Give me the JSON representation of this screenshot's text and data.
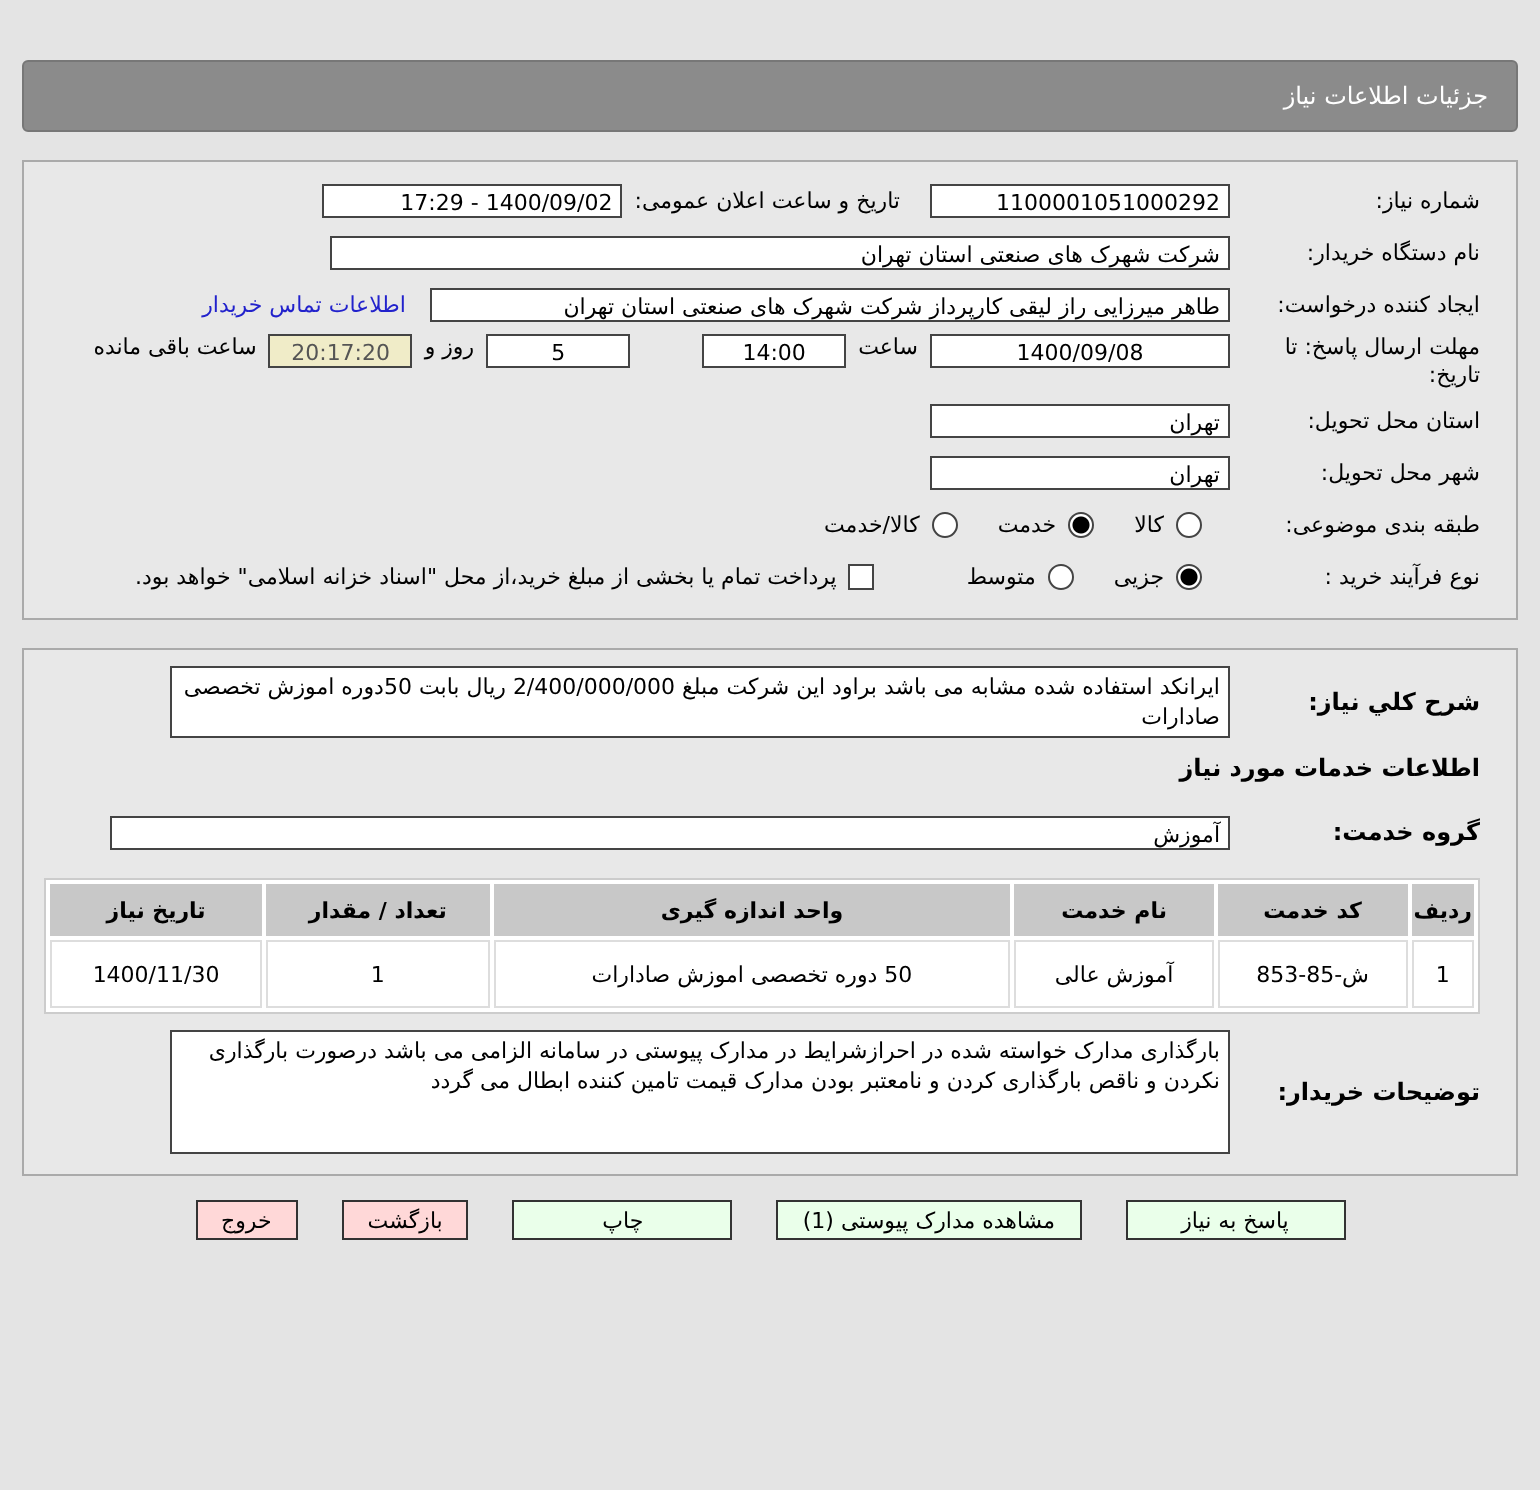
{
  "header": {
    "title": "جزئیات اطلاعات نیاز"
  },
  "details": {
    "need_number": {
      "label": "شماره نیاز:",
      "value": "1100001051000292"
    },
    "announce": {
      "label": "تاریخ و ساعت اعلان عمومی:",
      "value": "1400/09/02 - 17:29"
    },
    "buyer": {
      "label": "نام دستگاه خریدار:",
      "value": "شرکت شهرک های صنعتی استان تهران"
    },
    "requester": {
      "label": "ایجاد کننده درخواست:",
      "value": "طاهر  میرزایی راز لیقی کارپرداز شرکت شهرک های صنعتی استان تهران",
      "link": "اطلاعات تماس خریدار"
    },
    "deadline": {
      "label": "مهلت ارسال پاسخ: تا تاریخ:",
      "date": "1400/09/08",
      "time_label": "ساعت",
      "time": "14:00",
      "days": "5",
      "days_label": "روز و",
      "remaining": "20:17:20",
      "remaining_label": "ساعت باقی مانده"
    },
    "province": {
      "label": "استان محل تحویل:",
      "value": "تهران"
    },
    "city": {
      "label": "شهر محل تحویل:",
      "value": "تهران"
    },
    "category": {
      "label": "طبقه بندی موضوعی:",
      "options": [
        {
          "label": "کالا",
          "selected": false
        },
        {
          "label": "خدمت",
          "selected": true
        },
        {
          "label": "کالا/خدمت",
          "selected": false
        }
      ]
    },
    "process": {
      "label": "نوع فرآیند خرید :",
      "options": [
        {
          "label": "جزیی",
          "selected": true
        },
        {
          "label": "متوسط",
          "selected": false
        }
      ],
      "checkbox": {
        "label": "پرداخت تمام یا بخشی از مبلغ خرید،از محل \"اسناد خزانه اسلامی\" خواهد بود.",
        "checked": false
      }
    }
  },
  "needs": {
    "description": {
      "label": "شرح کلي نياز:",
      "value": "ایرانکد استفاده شده مشابه می باشد براود این شرکت مبلغ 2/400/000/000 ریال بابت 50دوره اموزش تخصصی صادارات"
    },
    "services_title": "اطلاعات خدمات مورد نیاز",
    "service_group": {
      "label": "گروه خدمت:",
      "value": "آموزش"
    },
    "table": {
      "columns": [
        "ردیف",
        "کد خدمت",
        "نام خدمت",
        "واحد اندازه گیری",
        "تعداد / مقدار",
        "تاریخ نیاز"
      ],
      "rows": [
        [
          "1",
          "ش-85-853",
          "آموزش عالی",
          "50 دوره تخصصی اموزش صادارات",
          "1",
          "1400/11/30"
        ]
      ]
    },
    "buyer_notes": {
      "label": "توضیحات خریدار:",
      "value": "بارگذاری مدارک خواسته شده در احرازشرایط در مدارک پیوستی در سامانه الزامی می باشد درصورت بارگذاری نکردن و ناقص بارگذاری کردن و نامعتبر بودن مدارک قیمت تامین کننده ابطال می گردد"
    }
  },
  "buttons": [
    {
      "label": "پاسخ به نیاز",
      "kind": "green"
    },
    {
      "label": "مشاهده مدارک پیوستی (1)",
      "kind": "green"
    },
    {
      "label": "چاپ",
      "kind": "green"
    },
    {
      "label": "بازگشت",
      "kind": "red"
    },
    {
      "label": "خروج",
      "kind": "red"
    }
  ]
}
